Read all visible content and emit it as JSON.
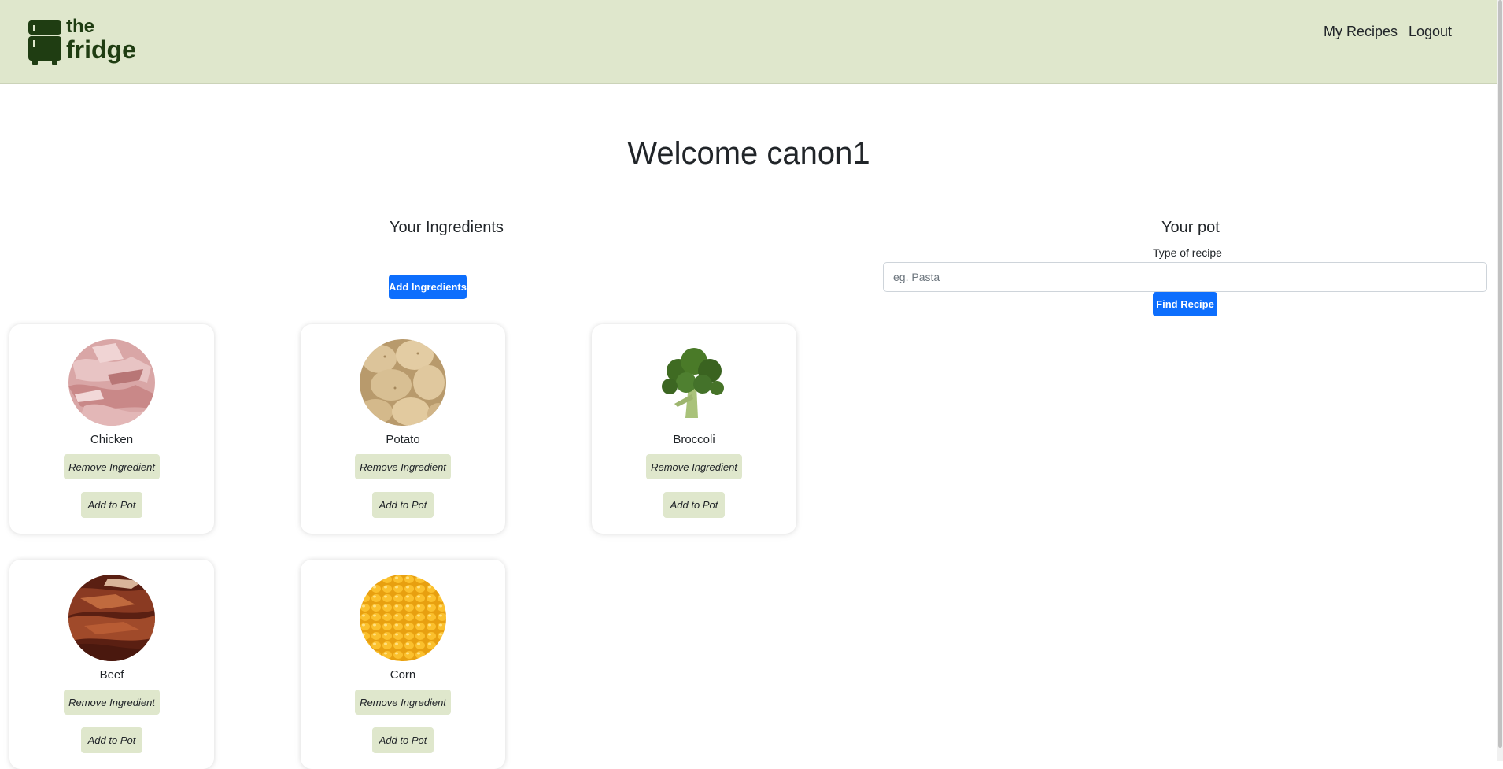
{
  "navbar": {
    "logo_the": "the",
    "logo_fridge": "fridge",
    "links": [
      {
        "label": "My Recipes"
      },
      {
        "label": "Logout"
      }
    ]
  },
  "welcome": "Welcome canon1",
  "ingredients_section": {
    "title": "Your Ingredients",
    "add_button": "Add Ingredients",
    "cards": [
      {
        "name": "Chicken",
        "remove_label": "Remove Ingredient",
        "add_label": "Add to Pot",
        "image": "chicken-image"
      },
      {
        "name": "Potato",
        "remove_label": "Remove Ingredient",
        "add_label": "Add to Pot",
        "image": "potato-image"
      },
      {
        "name": "Broccoli",
        "remove_label": "Remove Ingredient",
        "add_label": "Add to Pot",
        "image": "broccoli-image"
      },
      {
        "name": "Beef",
        "remove_label": "Remove Ingredient",
        "add_label": "Add to Pot",
        "image": "beef-image"
      },
      {
        "name": "Corn",
        "remove_label": "Remove Ingredient",
        "add_label": "Add to Pot",
        "image": "corn-image"
      }
    ]
  },
  "pot_section": {
    "title": "Your pot",
    "type_label": "Type of recipe",
    "input_value": "",
    "input_placeholder": "eg. Pasta",
    "find_button": "Find Recipe"
  },
  "colors": {
    "navbar_bg": "#dfe7cc",
    "logo": "#1f3d12",
    "primary": "#0d6efd",
    "soft_button": "#dfe7cc"
  }
}
